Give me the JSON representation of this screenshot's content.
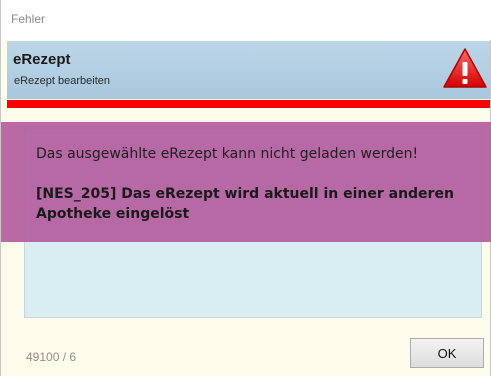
{
  "window": {
    "title": "Fehler"
  },
  "header": {
    "title": "eRezept",
    "subtitle": "eRezept bearbeiten",
    "icon": "warning-icon",
    "accent_color": "#ff0000"
  },
  "message": {
    "line1": "Das ausgewählte eRezept kann nicht geladen werden!",
    "line2": "[NES_205] Das eRezept wird aktuell in einer anderen Apotheke eingelöst"
  },
  "footer": {
    "status": "49100 / 6",
    "ok_label": "OK"
  },
  "colors": {
    "header_bg": "#bcd6e8",
    "highlight_band": "#b35d9d",
    "content_bg": "#d9eef2",
    "dialog_bg": "#fdfbea"
  }
}
